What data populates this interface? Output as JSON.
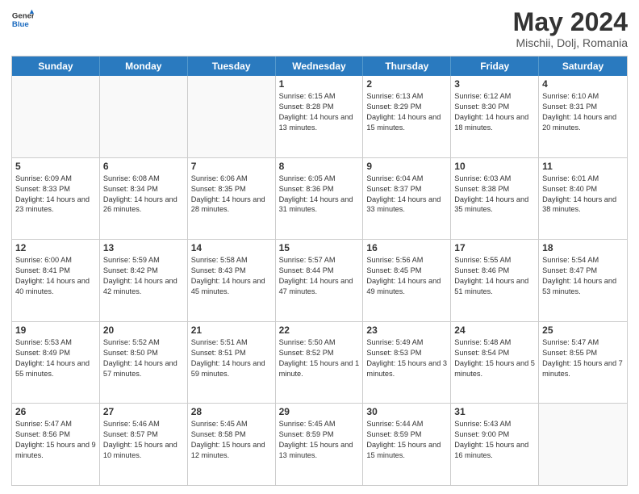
{
  "header": {
    "logo_line1": "General",
    "logo_line2": "Blue",
    "month_year": "May 2024",
    "location": "Mischii, Dolj, Romania"
  },
  "days_of_week": [
    "Sunday",
    "Monday",
    "Tuesday",
    "Wednesday",
    "Thursday",
    "Friday",
    "Saturday"
  ],
  "weeks": [
    [
      {
        "day": "",
        "empty": true
      },
      {
        "day": "",
        "empty": true
      },
      {
        "day": "",
        "empty": true
      },
      {
        "day": "1",
        "sunrise": "6:15 AM",
        "sunset": "8:28 PM",
        "daylight": "14 hours and 13 minutes."
      },
      {
        "day": "2",
        "sunrise": "6:13 AM",
        "sunset": "8:29 PM",
        "daylight": "14 hours and 15 minutes."
      },
      {
        "day": "3",
        "sunrise": "6:12 AM",
        "sunset": "8:30 PM",
        "daylight": "14 hours and 18 minutes."
      },
      {
        "day": "4",
        "sunrise": "6:10 AM",
        "sunset": "8:31 PM",
        "daylight": "14 hours and 20 minutes."
      }
    ],
    [
      {
        "day": "5",
        "sunrise": "6:09 AM",
        "sunset": "8:33 PM",
        "daylight": "14 hours and 23 minutes."
      },
      {
        "day": "6",
        "sunrise": "6:08 AM",
        "sunset": "8:34 PM",
        "daylight": "14 hours and 26 minutes."
      },
      {
        "day": "7",
        "sunrise": "6:06 AM",
        "sunset": "8:35 PM",
        "daylight": "14 hours and 28 minutes."
      },
      {
        "day": "8",
        "sunrise": "6:05 AM",
        "sunset": "8:36 PM",
        "daylight": "14 hours and 31 minutes."
      },
      {
        "day": "9",
        "sunrise": "6:04 AM",
        "sunset": "8:37 PM",
        "daylight": "14 hours and 33 minutes."
      },
      {
        "day": "10",
        "sunrise": "6:03 AM",
        "sunset": "8:38 PM",
        "daylight": "14 hours and 35 minutes."
      },
      {
        "day": "11",
        "sunrise": "6:01 AM",
        "sunset": "8:40 PM",
        "daylight": "14 hours and 38 minutes."
      }
    ],
    [
      {
        "day": "12",
        "sunrise": "6:00 AM",
        "sunset": "8:41 PM",
        "daylight": "14 hours and 40 minutes."
      },
      {
        "day": "13",
        "sunrise": "5:59 AM",
        "sunset": "8:42 PM",
        "daylight": "14 hours and 42 minutes."
      },
      {
        "day": "14",
        "sunrise": "5:58 AM",
        "sunset": "8:43 PM",
        "daylight": "14 hours and 45 minutes."
      },
      {
        "day": "15",
        "sunrise": "5:57 AM",
        "sunset": "8:44 PM",
        "daylight": "14 hours and 47 minutes."
      },
      {
        "day": "16",
        "sunrise": "5:56 AM",
        "sunset": "8:45 PM",
        "daylight": "14 hours and 49 minutes."
      },
      {
        "day": "17",
        "sunrise": "5:55 AM",
        "sunset": "8:46 PM",
        "daylight": "14 hours and 51 minutes."
      },
      {
        "day": "18",
        "sunrise": "5:54 AM",
        "sunset": "8:47 PM",
        "daylight": "14 hours and 53 minutes."
      }
    ],
    [
      {
        "day": "19",
        "sunrise": "5:53 AM",
        "sunset": "8:49 PM",
        "daylight": "14 hours and 55 minutes."
      },
      {
        "day": "20",
        "sunrise": "5:52 AM",
        "sunset": "8:50 PM",
        "daylight": "14 hours and 57 minutes."
      },
      {
        "day": "21",
        "sunrise": "5:51 AM",
        "sunset": "8:51 PM",
        "daylight": "14 hours and 59 minutes."
      },
      {
        "day": "22",
        "sunrise": "5:50 AM",
        "sunset": "8:52 PM",
        "daylight": "15 hours and 1 minute."
      },
      {
        "day": "23",
        "sunrise": "5:49 AM",
        "sunset": "8:53 PM",
        "daylight": "15 hours and 3 minutes."
      },
      {
        "day": "24",
        "sunrise": "5:48 AM",
        "sunset": "8:54 PM",
        "daylight": "15 hours and 5 minutes."
      },
      {
        "day": "25",
        "sunrise": "5:47 AM",
        "sunset": "8:55 PM",
        "daylight": "15 hours and 7 minutes."
      }
    ],
    [
      {
        "day": "26",
        "sunrise": "5:47 AM",
        "sunset": "8:56 PM",
        "daylight": "15 hours and 9 minutes."
      },
      {
        "day": "27",
        "sunrise": "5:46 AM",
        "sunset": "8:57 PM",
        "daylight": "15 hours and 10 minutes."
      },
      {
        "day": "28",
        "sunrise": "5:45 AM",
        "sunset": "8:58 PM",
        "daylight": "15 hours and 12 minutes."
      },
      {
        "day": "29",
        "sunrise": "5:45 AM",
        "sunset": "8:59 PM",
        "daylight": "15 hours and 13 minutes."
      },
      {
        "day": "30",
        "sunrise": "5:44 AM",
        "sunset": "8:59 PM",
        "daylight": "15 hours and 15 minutes."
      },
      {
        "day": "31",
        "sunrise": "5:43 AM",
        "sunset": "9:00 PM",
        "daylight": "15 hours and 16 minutes."
      },
      {
        "day": "",
        "empty": true
      }
    ]
  ],
  "labels": {
    "sunrise_prefix": "Sunrise: ",
    "sunset_prefix": "Sunset: ",
    "daylight_prefix": "Daylight: "
  }
}
